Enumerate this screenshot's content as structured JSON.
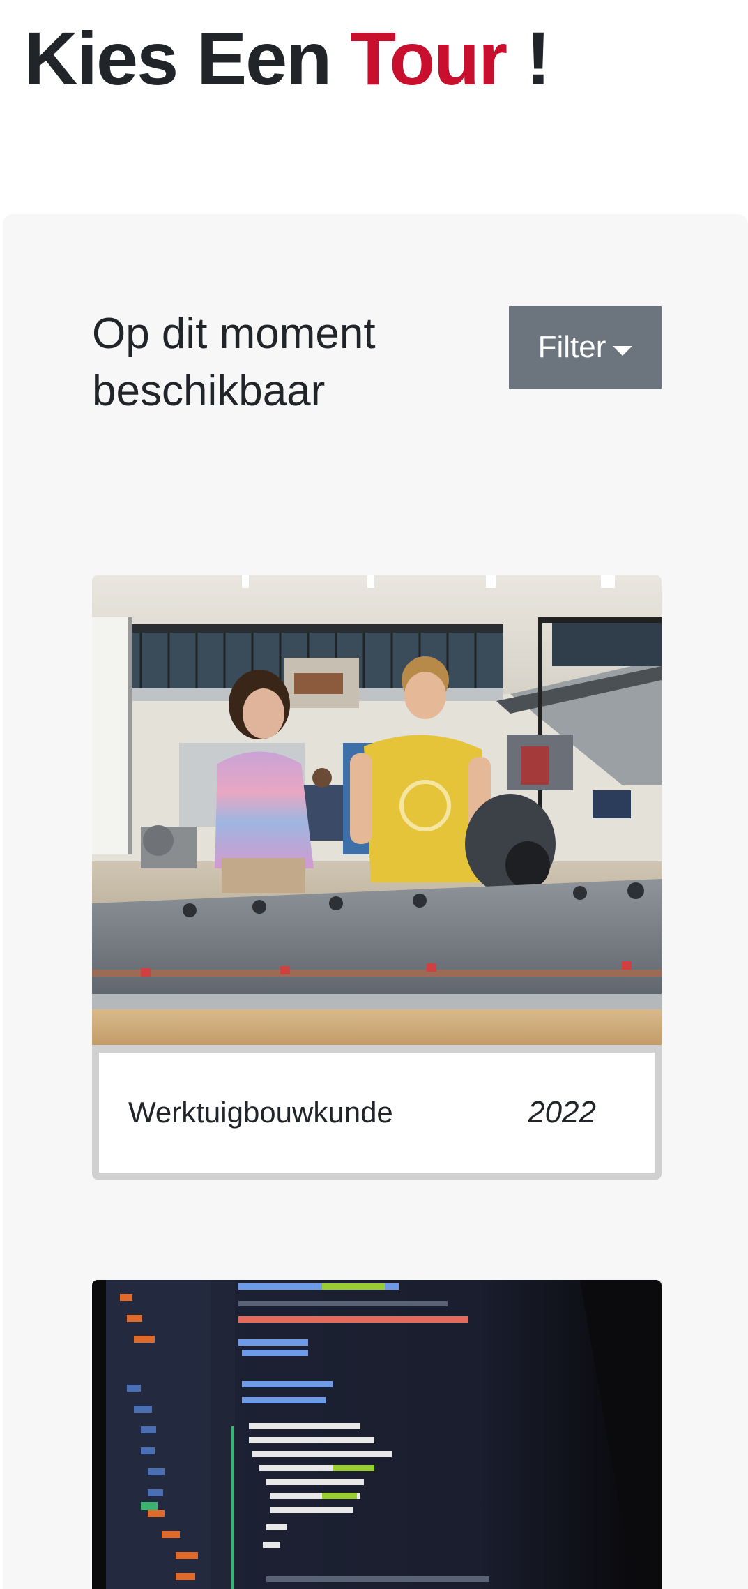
{
  "header": {
    "title_part1": "Kies Een",
    "title_accent": "Tour",
    "title_end": "!"
  },
  "section": {
    "heading": "Op dit moment beschikbaar",
    "filter_label": "Filter"
  },
  "tours": [
    {
      "name": "Werktuigbouwkunde",
      "year": "2022",
      "image": "workshop-photo"
    },
    {
      "image": "code-screen-photo"
    }
  ],
  "colors": {
    "accent": "#c8102e",
    "filter_button": "#6c757d",
    "panel_background": "#f7f7f7",
    "text": "#212529"
  }
}
